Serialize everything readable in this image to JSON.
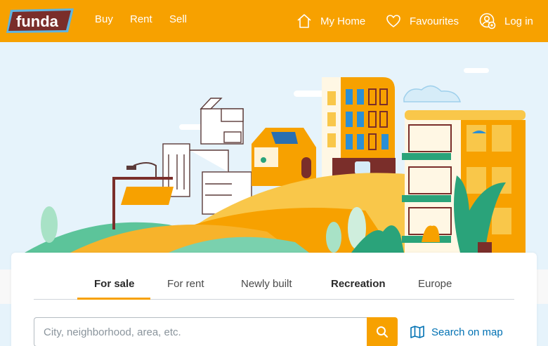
{
  "header": {
    "logo_text": "funda",
    "nav": [
      {
        "label": "Buy"
      },
      {
        "label": "Rent"
      },
      {
        "label": "Sell"
      }
    ],
    "my_home_label": "My Home",
    "favourites_label": "Favourites",
    "login_label": "Log in"
  },
  "search_card": {
    "tabs": [
      {
        "label": "For sale",
        "active": true
      },
      {
        "label": "For rent",
        "active": false
      },
      {
        "label": "Newly built",
        "active": false
      },
      {
        "label": "Recreation",
        "active": false
      },
      {
        "label": "Europe",
        "active": false
      }
    ],
    "search": {
      "placeholder": "City, neighborhood, area, etc.",
      "value": ""
    },
    "map_link_label": "Search on map"
  },
  "colors": {
    "brand_orange": "#f7a100",
    "link_blue": "#0071b3",
    "sky": "#e6f3fb"
  },
  "icons": [
    "home-icon",
    "heart-icon",
    "user-icon",
    "search-icon",
    "map-icon"
  ]
}
